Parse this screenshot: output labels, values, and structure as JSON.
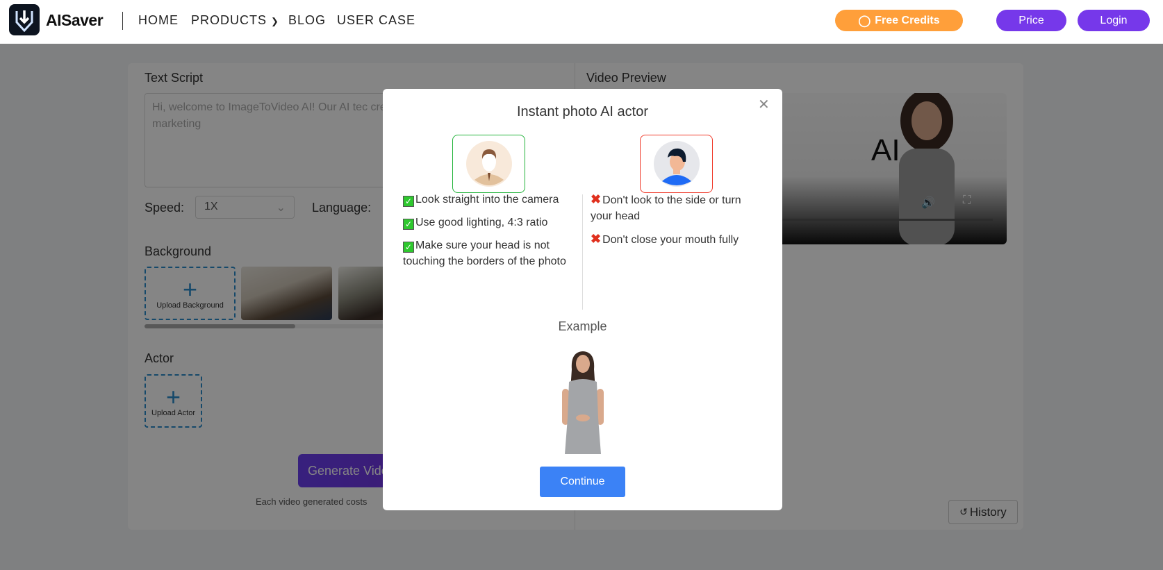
{
  "header": {
    "brand": "AISaver",
    "nav": [
      "HOME",
      "PRODUCTS",
      "BLOG",
      "USER CASE"
    ],
    "free_credits": "Free Credits",
    "price": "Price",
    "login": "Login",
    "colors": {
      "orange": "#ff9f3a",
      "purple": "#7638ea"
    }
  },
  "left": {
    "text_script_label": "Text Script",
    "script_placeholder": "Hi, welcome to ImageToVideo AI! Our AI tec create content and leverage your marketing",
    "speed_label": "Speed:",
    "speed_value": "1X",
    "language_label": "Language:",
    "background_label": "Background",
    "upload_background": "Upload Background",
    "actor_label": "Actor",
    "upload_actor": "Upload Actor",
    "generate_button": "Generate Video",
    "cost_note": "Each video generated costs"
  },
  "right": {
    "video_preview_label": "Video Preview",
    "video_text": "AI",
    "history": "History"
  },
  "modal": {
    "title": "Instant photo AI actor",
    "do_items": [
      "Look straight into the camera",
      "Use good lighting, 4:3 ratio",
      "Make sure your head is not touching the borders of the photo"
    ],
    "dont_items": [
      "Don't look to the side or turn your head",
      "Don't close your mouth fully"
    ],
    "example_label": "Example",
    "continue": "Continue",
    "colors": {
      "good": "#22b33a",
      "bad": "#f03a2a",
      "button": "#3b82f6"
    }
  }
}
